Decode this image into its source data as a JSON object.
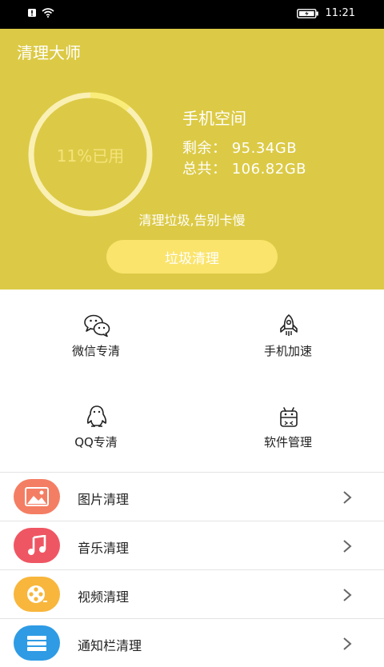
{
  "status": {
    "time": "11:21"
  },
  "app": {
    "title": "清理大师"
  },
  "storage": {
    "usage_label": "11%已用",
    "used_fraction": 0.11,
    "title": "手机空间",
    "remaining": "剩余：  95.34GB",
    "total": "总共：  106.82GB"
  },
  "hero": {
    "slogan": "清理垃圾,告别卡慢",
    "button": "垃圾清理"
  },
  "grid": [
    {
      "label": "微信专清",
      "icon": "wechat-icon"
    },
    {
      "label": "手机加速",
      "icon": "rocket-icon"
    },
    {
      "label": "QQ专清",
      "icon": "qq-penguin-icon"
    },
    {
      "label": "软件管理",
      "icon": "android-icon"
    }
  ],
  "list": [
    {
      "label": "图片清理",
      "icon": "image-icon",
      "color": "#f47e63"
    },
    {
      "label": "音乐清理",
      "icon": "music-icon",
      "color": "#ef5663"
    },
    {
      "label": "视频清理",
      "icon": "film-reel-icon",
      "color": "#f8b63c"
    },
    {
      "label": "通知栏清理",
      "icon": "notification-icon",
      "color": "#2e9be4"
    }
  ],
  "colors": {
    "accent": "#dcca46",
    "button": "#fae46c",
    "ring_track": "#faf0b4",
    "ring_used": "#faec78"
  }
}
